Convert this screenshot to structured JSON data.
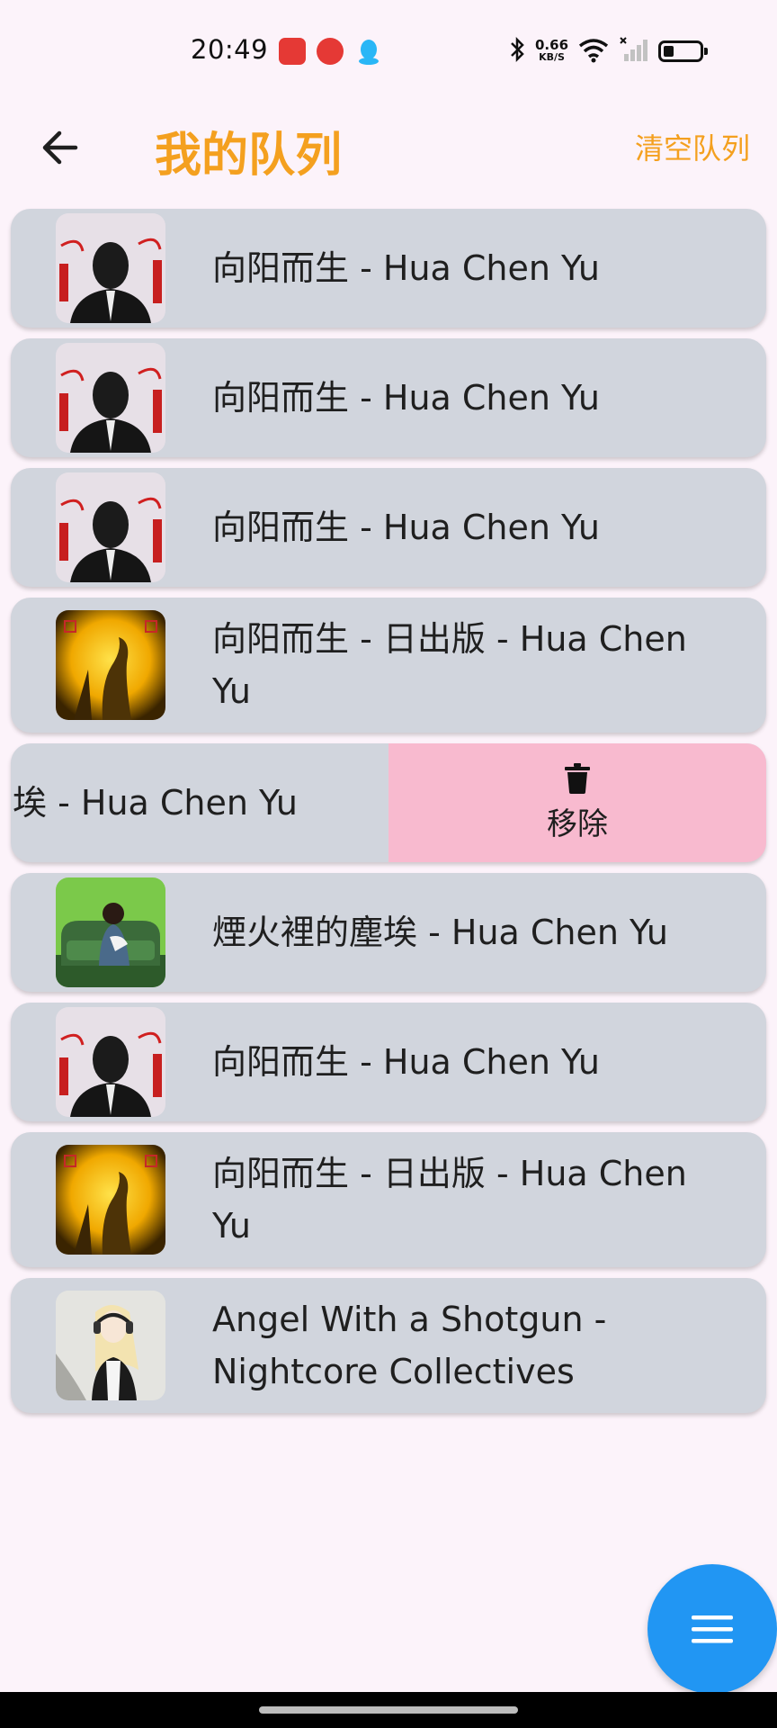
{
  "status_bar": {
    "time": "20:49",
    "net_speed": "0.66",
    "net_unit": "KB/S",
    "battery_level": 0.3,
    "icons": [
      "bluetooth-icon",
      "wifi-icon",
      "signal-icon",
      "battery-icon"
    ]
  },
  "header": {
    "title": "我的队列",
    "clear_label": "清空队列",
    "accent_color": "#f4a01f"
  },
  "queue": {
    "items": [
      {
        "title": "向阳而生 - Hua Chen Yu",
        "cover": "hope-album-cover"
      },
      {
        "title": "向阳而生 - Hua Chen Yu",
        "cover": "hope-album-cover"
      },
      {
        "title": "向阳而生 - Hua Chen Yu",
        "cover": "hope-album-cover"
      },
      {
        "title": "向阳而生 - 日出版 - Hua Chen Yu",
        "cover": "sunrise-album-cover"
      },
      {
        "title": "埃 - Hua Chen Yu",
        "swiped": true,
        "remove_label": "移除"
      },
      {
        "title": "煙火裡的塵埃 - Hua Chen Yu",
        "cover": "green-sofa-album-cover"
      },
      {
        "title": "向阳而生 - Hua Chen Yu",
        "cover": "hope-album-cover"
      },
      {
        "title": "向阳而生 - 日出版 - Hua Chen Yu",
        "cover": "sunrise-album-cover"
      },
      {
        "title": "Angel With a Shotgun - Nightcore Collectives",
        "cover": "anime-girl-cover"
      }
    ]
  },
  "fab": {
    "icon": "menu-icon",
    "color": "#2196f3"
  },
  "colors": {
    "background": "#fcf3fa",
    "card": "#d1d5dd",
    "remove_bg": "#f8bacf"
  }
}
